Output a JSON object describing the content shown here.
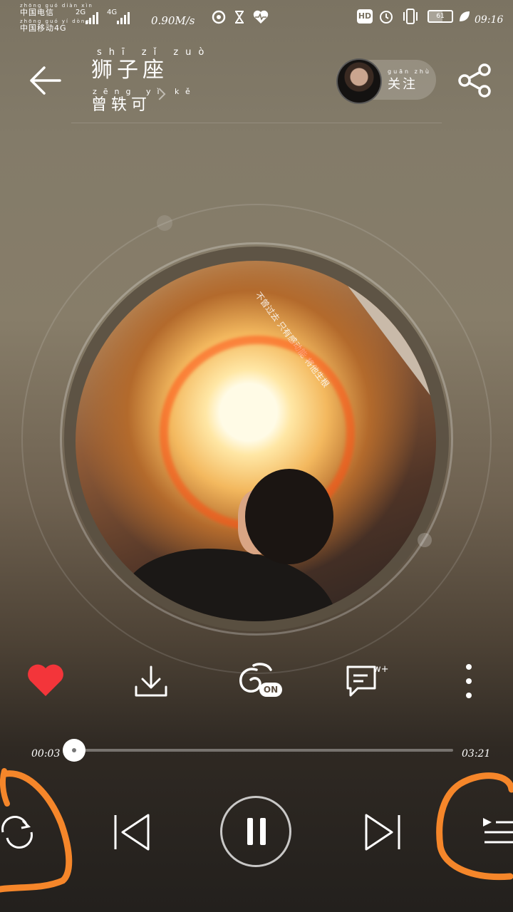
{
  "status_bar": {
    "carrier1_pinyin": "zhōng guó diàn xìn",
    "carrier1": "中国电信",
    "carrier2_pinyin": "zhōng guó yí dòng",
    "carrier2": "中国移动4G",
    "net1": "2G",
    "net2": "4G",
    "speed": "0.90M/s",
    "hd": "HD",
    "battery": "61",
    "time": "09:16"
  },
  "header": {
    "title_pinyin": "shī zǐ zuò",
    "title": "狮子座",
    "artist_pinyin": "zēng yì kě",
    "artist": "曾轶可",
    "follow_pinyin": "guān zhù",
    "follow": "关注"
  },
  "cover": {
    "band_text": "不曾过去 只有感动能 将他生根"
  },
  "actions": {
    "comment_badge": "w+",
    "effect_badge": "ON"
  },
  "player": {
    "elapsed": "00:03",
    "duration": "03:21",
    "progress": 0.016
  },
  "colors": {
    "like": "#f3353a",
    "annotation": "#f5862a"
  }
}
